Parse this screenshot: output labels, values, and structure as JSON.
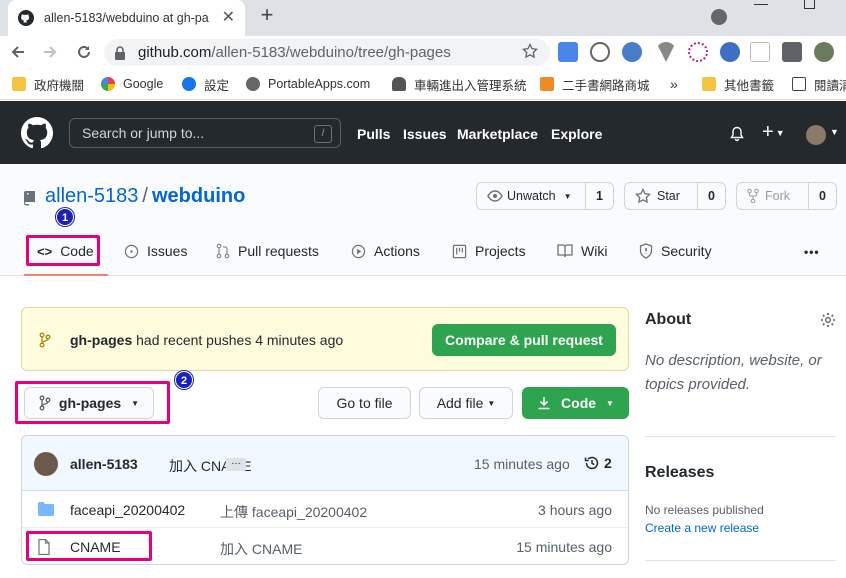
{
  "browser": {
    "tab_title": "allen-5183/webduino at gh-pa",
    "tab_close": "✕",
    "new_tab": "+",
    "url_host": "github.com",
    "url_path": "/allen-5183/webduino/tree/gh-pages",
    "bookmarks": [
      "政府機關",
      "Google",
      "設定",
      "PortableApps.com",
      "車輛進出入管理系統",
      "二手書網路商城",
      "»",
      "其他書籤",
      "閱讀清"
    ]
  },
  "gh": {
    "search_placeholder": "Search or jump to...",
    "search_shortcut": "/",
    "nav": [
      "Pulls",
      "Issues",
      "Marketplace",
      "Explore"
    ],
    "plus": "+"
  },
  "repo": {
    "owner": "allen-5183",
    "separator": "/",
    "name": "webduino",
    "unwatch_label": "Unwatch",
    "unwatch_count": "1",
    "star_label": "Star",
    "star_count": "0",
    "fork_label": "Fork",
    "fork_count": "0",
    "tabs": [
      "Code",
      "Issues",
      "Pull requests",
      "Actions",
      "Projects",
      "Wiki",
      "Security"
    ],
    "more": "•••"
  },
  "annotations": [
    "1",
    "2"
  ],
  "flash": {
    "branch": "gh-pages",
    "message": "had recent pushes 4 minutes ago",
    "button": "Compare & pull request"
  },
  "toolbar": {
    "branch": "gh-pages",
    "goto_file": "Go to file",
    "add_file": "Add file",
    "code": "Code"
  },
  "commit": {
    "author": "allen-5183",
    "message": "加入 CNAME",
    "ellipsis": "…",
    "time": "15 minutes ago",
    "history_count": "2"
  },
  "files": [
    {
      "type": "folder",
      "name": "faceapi_20200402",
      "message": "上傳 faceapi_20200402",
      "time": "3 hours ago"
    },
    {
      "type": "file",
      "name": "CNAME",
      "message": "加入 CNAME",
      "time": "15 minutes ago"
    }
  ],
  "sidebar": {
    "about_title": "About",
    "about_text": "No description, website, or topics provided.",
    "releases_title": "Releases",
    "no_releases": "No releases published",
    "create_release": "Create a new release"
  },
  "colors": {
    "highlight": "#e6007e",
    "badge": "#1a22b8",
    "primary_green": "#2ea44f",
    "link_blue": "#0366d6"
  }
}
